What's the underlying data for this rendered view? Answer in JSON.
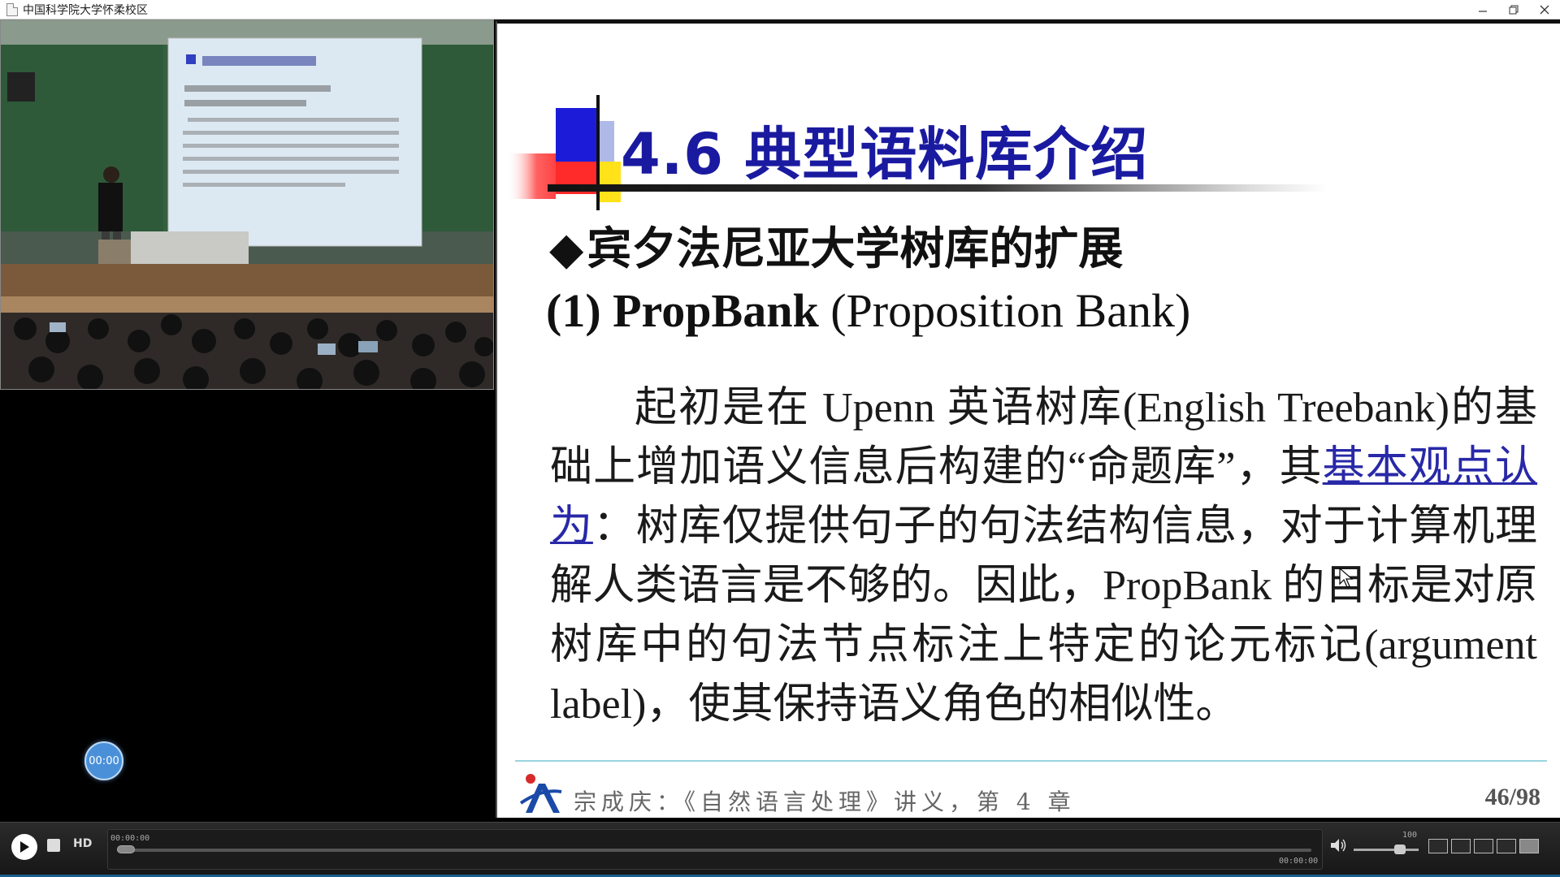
{
  "window": {
    "title": "中国科学院大学怀柔校区",
    "minimize_icon": "minimize-icon",
    "restore_icon": "restore-icon",
    "close_icon": "close-icon"
  },
  "left_panel": {
    "timer_bubble": "00:00"
  },
  "slide": {
    "title": "4.6 典型语料库介绍",
    "bullet_heading": "宾夕法尼亚大学树库的扩展",
    "bullet_symbol": "◆",
    "subheading_bold": "(1) PropBank",
    "subheading_rest": " (Proposition Bank)",
    "body_part1": "起初是在 Upenn 英语树库(English Treebank)的基础上增加语义信息后构建的“命题库”，其",
    "body_link": "基本观点认为",
    "body_part2": "：树库仅提供句子的句法结构信息，对于计算机理解人类语言是不够的。因此，PropBank 的目标是对原树库中的句法节点标注上特定的论元标记(argument label)，使其保持语义角色的相似性。",
    "footer_text": "宗成庆：《自然语言处理》讲义，第 4 章",
    "page_number": "46/98"
  },
  "player": {
    "hd_label": "HD",
    "time_elapsed": "00:00:00",
    "time_total": "00:00:00",
    "volume_max": "100",
    "progress": 0,
    "volume": 0.75
  },
  "colors": {
    "slide_title": "#1a1aa0",
    "link": "#2828a8",
    "timer_bubble": "#4a90d9"
  }
}
